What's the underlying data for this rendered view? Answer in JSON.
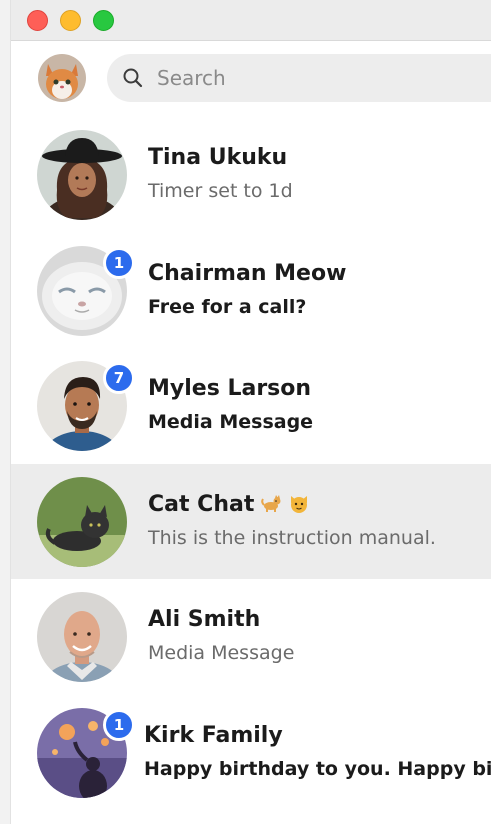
{
  "search": {
    "placeholder": "Search",
    "value": ""
  },
  "colors": {
    "accent": "#2c6bed",
    "selected_row": "#ececec",
    "search_bg": "#ededed"
  },
  "conversations": [
    {
      "name": "Tina Ukuku",
      "snippet": "Timer set to 1d",
      "unread": null,
      "avatar": "woman-with-hat-avatar"
    },
    {
      "name": "Chairman Meow",
      "snippet": "Free for a call?",
      "unread": "1",
      "avatar": "white-cat-avatar"
    },
    {
      "name": "Myles Larson",
      "snippet": "Media Message",
      "unread": "7",
      "avatar": "man-avatar"
    },
    {
      "name": "Cat Chat",
      "snippet": "This is the instruction manual.",
      "unread": null,
      "avatar": "black-cat-avatar",
      "emojis": [
        "cat-emoji",
        "cat-face-emoji"
      ]
    },
    {
      "name": "Ali Smith",
      "snippet": "Media Message",
      "unread": null,
      "avatar": "bald-man-avatar"
    },
    {
      "name": "Kirk Family",
      "snippet": "Happy birthday to you. Happy birthday to you.",
      "unread": "1",
      "avatar": "lanterns-avatar"
    }
  ]
}
